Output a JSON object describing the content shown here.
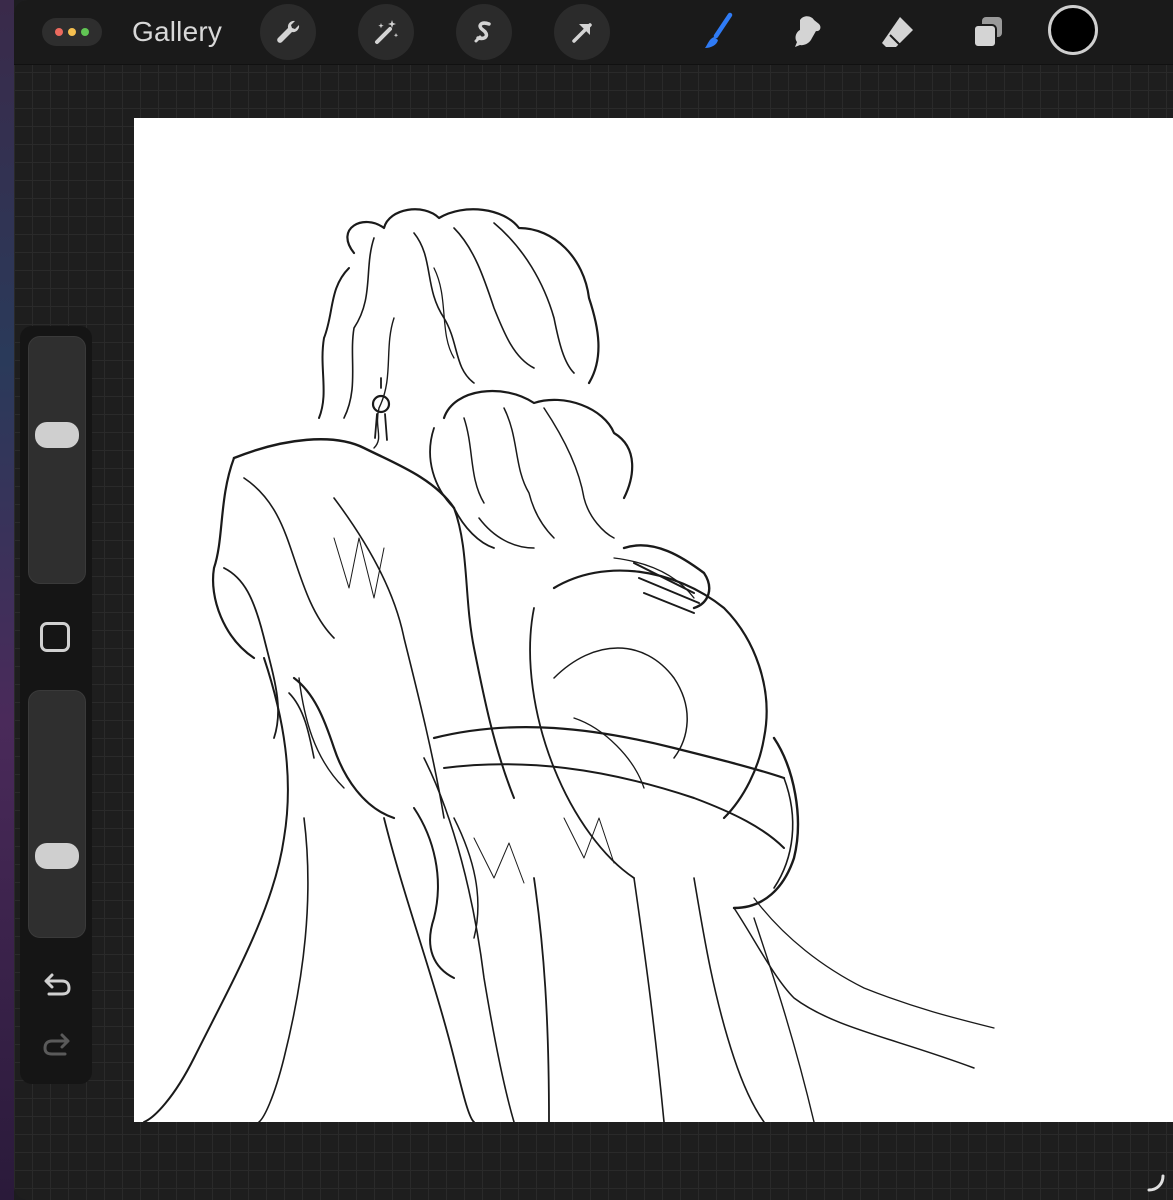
{
  "window": {
    "dots": [
      "#ec6a5e",
      "#f4bf4f",
      "#61c554"
    ]
  },
  "topbar": {
    "gallery_label": "Gallery",
    "tools_left": [
      "wrench-icon",
      "magic-wand-icon",
      "selection-icon",
      "transform-arrow-icon"
    ],
    "tools_right": [
      "brush-icon",
      "smudge-icon",
      "eraser-icon",
      "layers-icon"
    ],
    "active_tool": "brush-icon",
    "accent_color": "#2f7bf5",
    "current_color": "#000000"
  },
  "sidebar": {
    "brush_size_level": 0.62,
    "opacity_level": 0.3,
    "modify_icon": "square-icon",
    "undo_icon": "undo-arrow-icon",
    "redo_icon": "redo-arrow-icon"
  }
}
